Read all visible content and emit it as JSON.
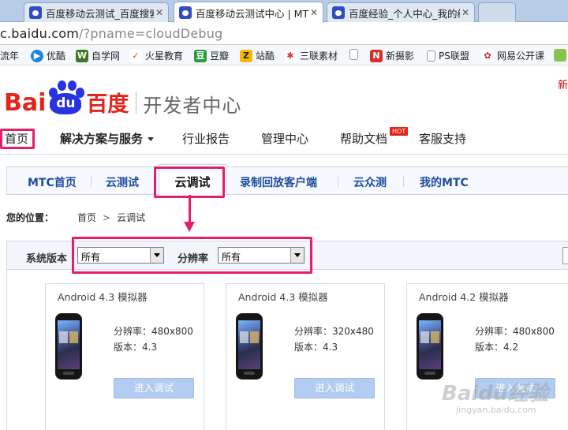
{
  "browser": {
    "tabs": [
      {
        "title": "百度移动云测试_百度搜索",
        "active": false
      },
      {
        "title": "百度移动云测试中心 | MT",
        "active": true
      },
      {
        "title": "百度经验_个人中心_我的经",
        "active": false
      }
    ],
    "url_main": "c.baidu.com",
    "url_rest": "/?pname=cloudDebug",
    "bookmarks": [
      {
        "label": "流年",
        "icon": "bookmark-icon",
        "color": "#888888"
      },
      {
        "label": "优酷",
        "icon": "youku-icon",
        "color": "#1e86dc"
      },
      {
        "label": "自学网",
        "icon": "zixuewang-icon",
        "color": "#3b7a1e"
      },
      {
        "label": "火星教育",
        "icon": "huoxing-icon",
        "color": "#d23b2b"
      },
      {
        "label": "豆瓣",
        "icon": "douban-icon",
        "color": "#2d9a3b"
      },
      {
        "label": "站酷",
        "icon": "zcool-icon",
        "color": "#f5b800"
      },
      {
        "label": "三联素材",
        "icon": "sanlian-icon",
        "color": "#d9342b"
      },
      {
        "label": "",
        "icon": "page-icon",
        "color": "#999999"
      },
      {
        "label": "新摄影",
        "icon": "xinsheying-icon",
        "color": "#d32f2f"
      },
      {
        "label": "PS联盟",
        "icon": "page-icon",
        "color": "#999999"
      },
      {
        "label": "网易公开课",
        "icon": "netease-icon",
        "color": "#c62828"
      }
    ]
  },
  "site": {
    "topright": "新",
    "logo": {
      "bai": "Bai",
      "du": "du",
      "cn": "百度",
      "product": "开发者中心"
    },
    "mainnav": [
      {
        "label": "首页"
      },
      {
        "label": "解决方案与服务"
      },
      {
        "label": "行业报告"
      },
      {
        "label": "管理中心"
      },
      {
        "label": "帮助文档"
      },
      {
        "label": "客服支持"
      }
    ],
    "hot_badge": "HOT",
    "subnav": [
      {
        "label": "MTC首页"
      },
      {
        "label": "云测试"
      },
      {
        "label": "云调试"
      },
      {
        "label": "录制回放客户端"
      },
      {
        "label": "云众测"
      },
      {
        "label": "我的MTC"
      }
    ],
    "breadcrumb": {
      "prefix": "您的位置：",
      "home": "首页",
      "sep": ">",
      "current": "云调试"
    },
    "filters": {
      "os_label": "系统版本",
      "os_value": "所有",
      "res_label": "分辨率",
      "res_value": "所有"
    },
    "devices": [
      {
        "title": "Android 4.3 模拟器",
        "res": "分辨率：480x800",
        "ver": "版本：4.3",
        "button": "进入调试"
      },
      {
        "title": "Android 4.3 模拟器",
        "res": "分辨率：320x480",
        "ver": "版本：4.3",
        "button": "进入调试"
      },
      {
        "title": "Android 4.2 模拟器",
        "res": "分辨率：480x800",
        "ver": "版本：4.2",
        "button": "进入调试"
      }
    ],
    "watermark": "Baidu经验",
    "watermark_sub": "jingyan.baidu.com"
  }
}
